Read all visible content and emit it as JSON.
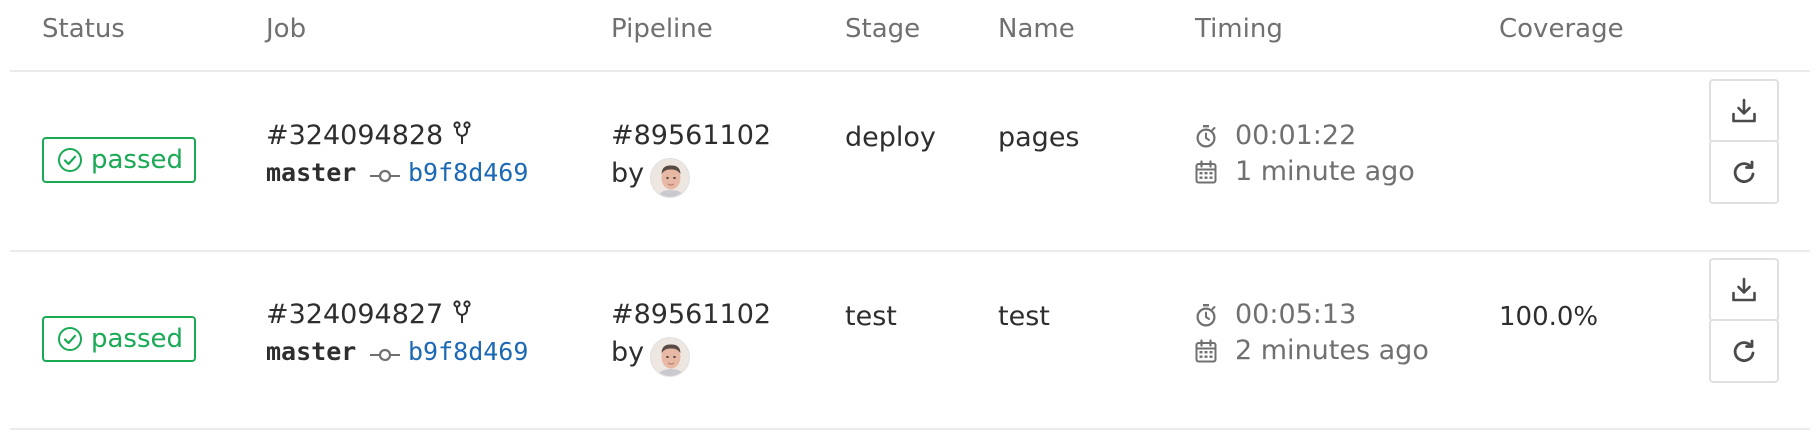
{
  "table": {
    "headers": {
      "status": "Status",
      "job": "Job",
      "pipeline": "Pipeline",
      "stage": "Stage",
      "name": "Name",
      "timing": "Timing",
      "coverage": "Coverage"
    },
    "rows": [
      {
        "status": "passed",
        "job_id": "#324094828",
        "ref": "master",
        "commit": "b9f8d469",
        "pipeline_id": "#89561102",
        "by": "by",
        "stage": "deploy",
        "name": "pages",
        "duration": "00:01:22",
        "finished": "1 minute ago",
        "coverage": ""
      },
      {
        "status": "passed",
        "job_id": "#324094827",
        "ref": "master",
        "commit": "b9f8d469",
        "pipeline_id": "#89561102",
        "by": "by",
        "stage": "test",
        "name": "test",
        "duration": "00:05:13",
        "finished": "2 minutes ago",
        "coverage": "100.0%"
      }
    ]
  },
  "colors": {
    "success": "#1aaa55",
    "link": "#1b69b6",
    "muted": "#707070",
    "border": "#e0e0e0"
  },
  "icons": {
    "status": "status-success-icon",
    "fork": "fork-icon",
    "commit": "commit-icon",
    "stopwatch": "stopwatch-icon",
    "calendar": "calendar-icon",
    "download": "download-icon",
    "retry": "retry-icon"
  }
}
